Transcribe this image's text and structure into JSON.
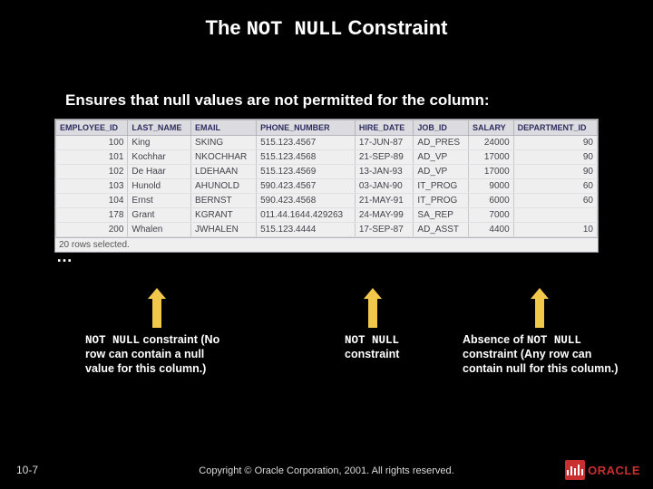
{
  "title": {
    "pre": "The ",
    "code": "NOT NULL",
    "post": " Constraint"
  },
  "subtitle": "Ensures that null values are not permitted for the column:",
  "columns": [
    "EMPLOYEE_ID",
    "LAST_NAME",
    "EMAIL",
    "PHONE_NUMBER",
    "HIRE_DATE",
    "JOB_ID",
    "SALARY",
    "DEPARTMENT_ID"
  ],
  "rows": [
    [
      "100",
      "King",
      "SKING",
      "515.123.4567",
      "17-JUN-87",
      "AD_PRES",
      "24000",
      "90"
    ],
    [
      "101",
      "Kochhar",
      "NKOCHHAR",
      "515.123.4568",
      "21-SEP-89",
      "AD_VP",
      "17000",
      "90"
    ],
    [
      "102",
      "De Haar",
      "LDEHAAN",
      "515.123.4569",
      "13-JAN-93",
      "AD_VP",
      "17000",
      "90"
    ],
    [
      "103",
      "Hunold",
      "AHUNOLD",
      "590.423.4567",
      "03-JAN-90",
      "IT_PROG",
      "9000",
      "60"
    ],
    [
      "104",
      "Ernst",
      "BERNST",
      "590.423.4568",
      "21-MAY-91",
      "IT_PROG",
      "6000",
      "60"
    ],
    [
      "178",
      "Grant",
      "KGRANT",
      "011.44.1644.429263",
      "24-MAY-99",
      "SA_REP",
      "7000",
      ""
    ],
    [
      "200",
      "Whalen",
      "JWHALEN",
      "515.123.4444",
      "17-SEP-87",
      "AD_ASST",
      "4400",
      "10"
    ]
  ],
  "status": "20 rows selected.",
  "ellipsis": "…",
  "captions": {
    "c1": {
      "code": "NOT NULL",
      "rest": " constraint (No row can contain a null value for this column.)"
    },
    "c2": {
      "code": "NOT NULL",
      "rest": " constraint"
    },
    "c3": {
      "pre": "Absence of ",
      "code": "NOT NULL",
      "rest": " constraint (Any row can contain null for this column.)"
    }
  },
  "footer": "Copyright © Oracle Corporation, 2001. All rights reserved.",
  "slide_num": "10-7",
  "logo": "ORACLE"
}
